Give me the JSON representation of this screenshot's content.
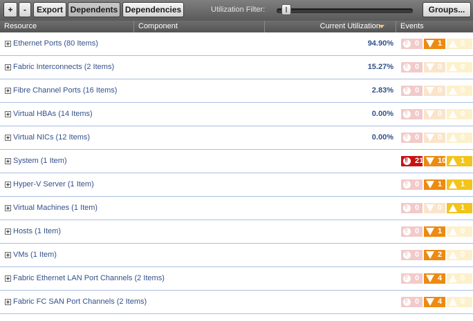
{
  "toolbar": {
    "expand_label": "+",
    "collapse_label": "-",
    "export_label": "Export",
    "dependents_label": "Dependents",
    "dependencies_label": "Dependencies",
    "filter_label": "Utilization Filter:",
    "filter_value": 0,
    "groups_label": "Groups..."
  },
  "columns": {
    "resource": "Resource",
    "component": "Component",
    "utilization": "Current Utilization",
    "events": "Events"
  },
  "colors": {
    "critical": "#c81212",
    "major": "#ec8a12",
    "minor": "#f2c41c"
  },
  "rows": [
    {
      "label": "Ethernet Ports (80 Items)",
      "util": "94.90%",
      "critical": "0",
      "major": "1",
      "minor": "0"
    },
    {
      "label": "Fabric Interconnects (2 Items)",
      "util": "15.27%",
      "critical": "0",
      "major": "0",
      "minor": "0"
    },
    {
      "label": "Fibre Channel Ports (16 Items)",
      "util": "2.83%",
      "critical": "0",
      "major": "0",
      "minor": "0"
    },
    {
      "label": "Virtual HBAs (14 Items)",
      "util": "0.00%",
      "critical": "0",
      "major": "0",
      "minor": "0"
    },
    {
      "label": "Virtual NICs (12 Items)",
      "util": "0.00%",
      "critical": "0",
      "major": "0",
      "minor": "0"
    },
    {
      "label": "System (1 Item)",
      "util": "",
      "critical": "21",
      "major": "107",
      "minor": "1"
    },
    {
      "label": "Hyper-V Server (1 Item)",
      "util": "",
      "critical": "0",
      "major": "1",
      "minor": "1"
    },
    {
      "label": "Virtual Machines (1 Item)",
      "util": "",
      "critical": "0",
      "major": "0",
      "minor": "1"
    },
    {
      "label": "Hosts (1 Item)",
      "util": "",
      "critical": "0",
      "major": "1",
      "minor": "0"
    },
    {
      "label": "VMs (1 Item)",
      "util": "",
      "critical": "0",
      "major": "2",
      "minor": "0"
    },
    {
      "label": "Fabric Ethernet LAN Port Channels (2 Items)",
      "util": "",
      "critical": "0",
      "major": "4",
      "minor": "0"
    },
    {
      "label": "Fabric FC SAN Port Channels (2 Items)",
      "util": "",
      "critical": "0",
      "major": "4",
      "minor": "0"
    }
  ]
}
